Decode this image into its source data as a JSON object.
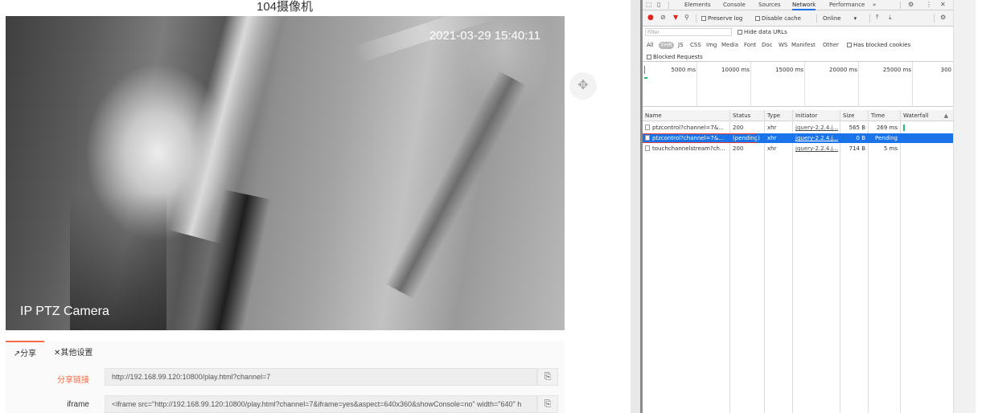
{
  "page": {
    "title": "104摄像机"
  },
  "video": {
    "timestamp": "2021-03-29 15:40:11",
    "caption": "IP PTZ Camera"
  },
  "move_handle": {
    "icon": "move-icon"
  },
  "share": {
    "tabs": [
      {
        "label": "↗分享",
        "active": true
      },
      {
        "label": "✕其他设置",
        "active": false
      }
    ],
    "rows": [
      {
        "label": "分享链接",
        "value": "http://192.168.99.120:10800/play.html?channel=7"
      },
      {
        "label": "iframe",
        "value": "<iframe src=\"http://192.168.99.120:10800/play.html?channel=7&iframe=yes&aspect=640x360&showConsole=no\" width=\"640\" h"
      }
    ],
    "accent_color": "#f46b45"
  },
  "devtools": {
    "tabs": [
      "Elements",
      "Console",
      "Sources",
      "Network",
      "Performance",
      "»"
    ],
    "active_tab": "Network",
    "toolbar": {
      "preserve_log": "Preserve log",
      "disable_cache": "Disable cache",
      "throttle": "Online",
      "throttle_arrow": "▾"
    },
    "filter": {
      "placeholder": "Filter",
      "hide_data_urls": "Hide data URLs",
      "types": [
        "All",
        "XHR",
        "JS",
        "CSS",
        "Img",
        "Media",
        "Font",
        "Doc",
        "WS",
        "Manifest",
        "Other"
      ],
      "active_type": "XHR",
      "has_blocked_cookies": "Has blocked cookies",
      "blocked_requests": "Blocked Requests"
    },
    "overview_ticks": [
      "5000 ms",
      "10000 ms",
      "15000 ms",
      "20000 ms",
      "25000 ms",
      "300"
    ],
    "columns": [
      "Name",
      "Status",
      "Type",
      "Initiator",
      "Size",
      "Time",
      "Waterfall"
    ],
    "sort_arrow": "▲",
    "requests": [
      {
        "name": "ptzcontrol?channel=7&...",
        "status": "200",
        "type": "xhr",
        "initiator": "jquery-2.2.4.j...",
        "size": "565 B",
        "time": "269 ms",
        "selected": false
      },
      {
        "name": "ptzcontrol?channel=7&...",
        "status": "(pending)",
        "type": "xhr",
        "initiator": "jquery-2.2.4.j...",
        "size": "0 B",
        "time": "Pending",
        "selected": true
      },
      {
        "name": "touchchannelstream?ch...",
        "status": "200",
        "type": "xhr",
        "initiator": "jquery-2.2.4.j...",
        "size": "714 B",
        "time": "5 ms",
        "selected": false
      }
    ],
    "selected_color": "#1a73e8",
    "record_color": "#e0241b"
  }
}
